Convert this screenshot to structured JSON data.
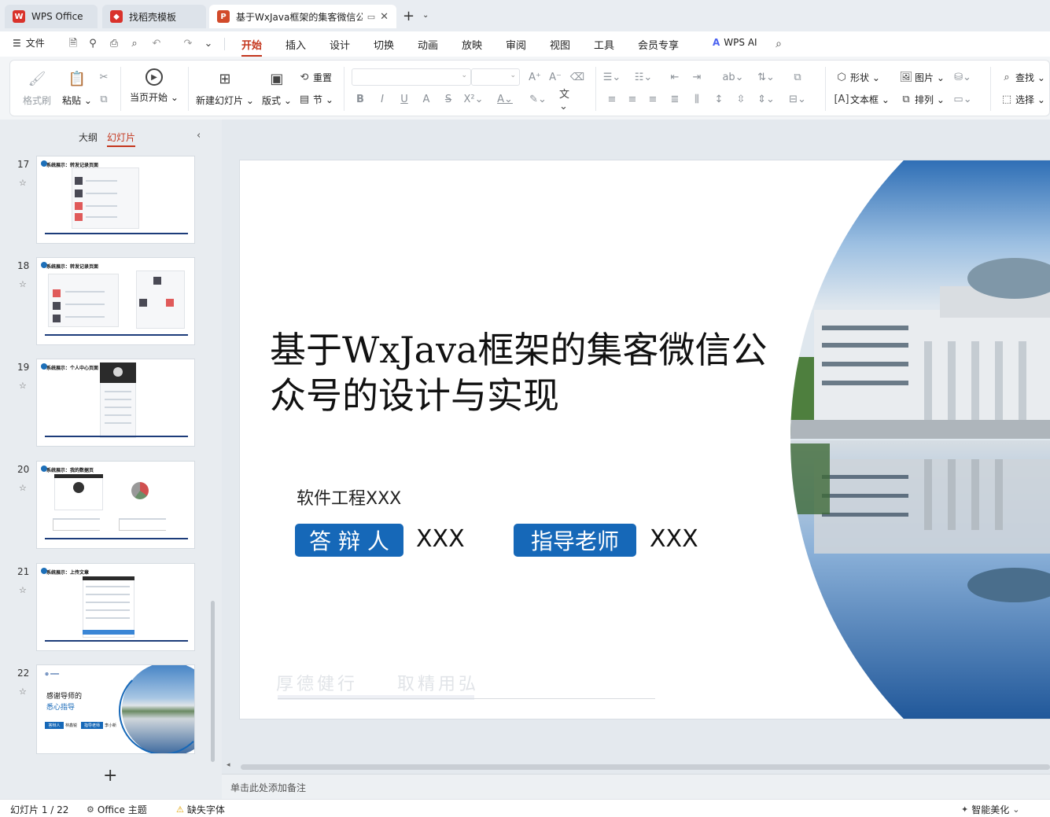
{
  "titlebar": {
    "tabs": [
      {
        "label": "WPS Office",
        "logo": "W",
        "logo_color": "#d9322b"
      },
      {
        "label": "找稻壳模板",
        "logo": "◆",
        "logo_color": "#d9322b"
      },
      {
        "label": "基于WxJava框架的集客微信公",
        "logo": "P",
        "logo_color": "#d24a2a"
      }
    ]
  },
  "menubar": {
    "file_label": "文件",
    "tabs": [
      "开始",
      "插入",
      "设计",
      "切换",
      "动画",
      "放映",
      "审阅",
      "视图",
      "工具",
      "会员专享"
    ],
    "ai_label": "WPS AI"
  },
  "ribbon": {
    "format_painter": "格式刷",
    "paste": "粘贴",
    "play_from_current": "当页开始",
    "new_slide": "新建幻灯片",
    "layout": "版式",
    "reset": "重置",
    "section": "节",
    "shape": "形状",
    "picture": "图片",
    "find": "查找",
    "textbox": "文本框",
    "arrange": "排列",
    "select": "选择"
  },
  "leftpanel": {
    "tabs": [
      "大纲",
      "幻灯片"
    ],
    "slides": [
      {
        "number": "17",
        "title": "系统展示：转发记录页面"
      },
      {
        "number": "18",
        "title": "系统展示：转发记录页面"
      },
      {
        "number": "19",
        "title": "系统展示：个人中心页面"
      },
      {
        "number": "20",
        "title": "系统展示：我的数据页"
      },
      {
        "number": "21",
        "title": "系统展示：上传文章"
      },
      {
        "number": "22",
        "title": "感谢导师的悉心指导",
        "line1": "感谢导师的",
        "line2": "悉心指导",
        "pill1": "答辩人",
        "name1": "林鑫锐",
        "pill2": "指导老师",
        "name2": "李小新"
      }
    ]
  },
  "slide": {
    "title": "基于WxJava框架的集客微信公众号的设计与实现",
    "major": "软件工程XXX",
    "defender_label": "答 辩 人",
    "defender_value": "XXX",
    "advisor_label": "指导老师",
    "advisor_value": "XXX",
    "motto_left": "厚德健行",
    "motto_right": "取精用弘"
  },
  "notes_placeholder": "单击此处添加备注",
  "statusbar": {
    "slide_counter": "幻灯片 1 / 22",
    "theme": "Office 主题",
    "missing_fonts": "缺失字体",
    "smart_beautify": "智能美化"
  },
  "colors": {
    "accent": "#c4361d",
    "slide_blue": "#1668b8"
  }
}
